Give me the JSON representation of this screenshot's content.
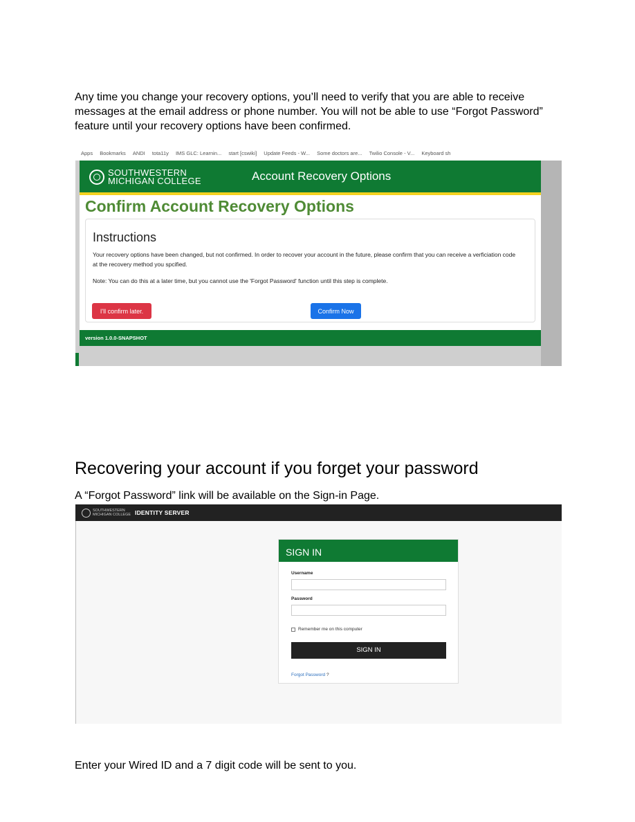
{
  "intro": "Any time you change your recovery options, you’ll need to verify that you are able to receive messages at the email address or phone number. You will not be able to use “Forgot Password” feature until your recovery options have been confirmed.",
  "screenshot1": {
    "bookmarks": [
      "Apps",
      "Bookmarks",
      "ANDI",
      "tota11y",
      "IMS GLC: Learnin...",
      "start [cswiki]",
      "Update Feeds - W...",
      "Some doctors are...",
      "Twilio Console - V...",
      "Keyboard sh"
    ],
    "logo_line1": "SOUTHWESTERN",
    "logo_line2": "MICHIGAN COLLEGE",
    "header_title": "Account Recovery Options",
    "page_title": "Confirm Account Recovery Options",
    "instructions_heading": "Instructions",
    "instructions_text": "Your recovery options have been changed, but not confirmed. In order to recover your account in the future, please confirm that you can receive a verficiation code at the recovery method you spcified.",
    "note_text": "Note: You can do this at a later time, but you cannot use the 'Forgot Password' function until this step is complete.",
    "later_button": "I'll confirm later.",
    "confirm_button": "Confirm Now",
    "version": "version 1.0.0-SNAPSHOT",
    "colors": {
      "brand_green": "#0f7a33",
      "accent_yellow": "#f4d21f",
      "title_green": "#4f8b35",
      "danger": "#dc3545",
      "primary": "#1a73e8"
    }
  },
  "section_heading": "Recovering your account if you forget your password",
  "link_note": "A “Forgot Password” link will be available on the Sign-in Page.",
  "screenshot2": {
    "logo_line1": "SOUTHWESTERN",
    "logo_line2": "MICHIGAN COLLEGE",
    "server_name": "IDENTITY SERVER",
    "card_title": "SIGN IN",
    "username_label": "Username",
    "password_label": "Password",
    "remember_label": "Remember me on this computer",
    "signin_button": "SIGN IN",
    "forgot_link": "Forgot Password",
    "forgot_suffix": "?"
  },
  "outro": "Enter your Wired ID and a 7 digit code will be sent to you."
}
